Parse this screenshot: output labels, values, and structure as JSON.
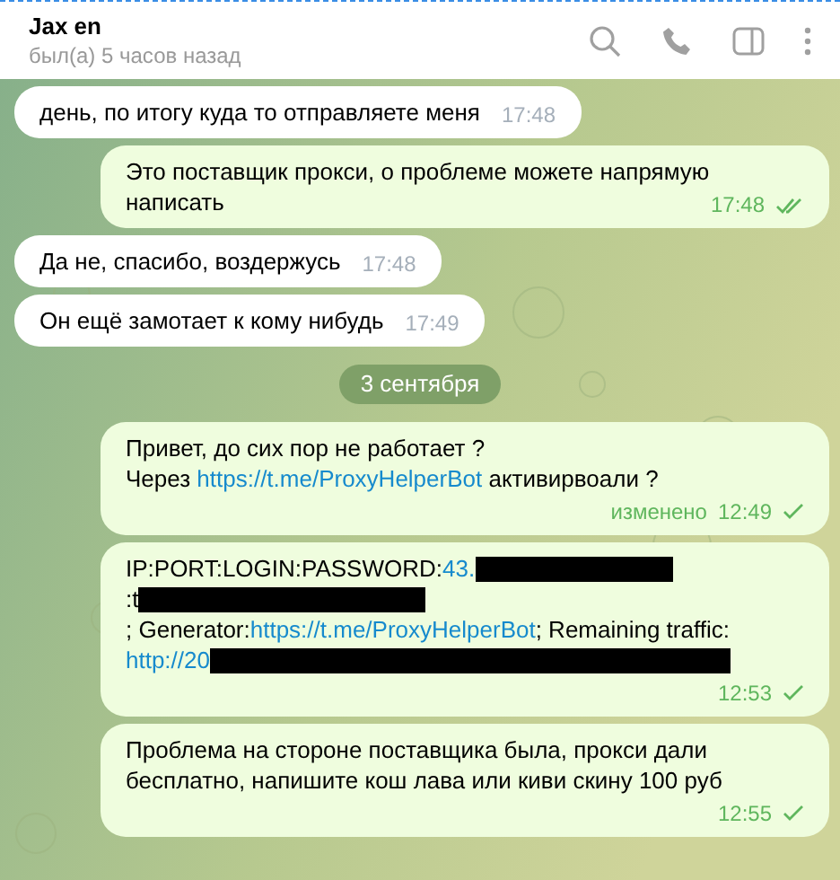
{
  "header": {
    "title": "Jax en",
    "status": "был(а) 5 часов назад"
  },
  "messages": [
    {
      "kind": "in",
      "segments": [
        {
          "kind": "text",
          "text": "день, по итогу куда то отправляете меня"
        }
      ],
      "time": "17:48"
    },
    {
      "kind": "out",
      "segments": [
        {
          "kind": "text",
          "text": "Это поставщик прокси, о проблеме можете напрямую написать"
        }
      ],
      "time": "17:48",
      "read": true
    },
    {
      "kind": "in",
      "segments": [
        {
          "kind": "text",
          "text": "Да не, спасибо, воздержусь"
        }
      ],
      "time": "17:48"
    },
    {
      "kind": "in",
      "segments": [
        {
          "kind": "text",
          "text": "Он ещё замотает к кому нибудь"
        }
      ],
      "time": "17:49"
    },
    {
      "kind": "date",
      "text": "3 сентября"
    },
    {
      "kind": "out",
      "segments": [
        {
          "kind": "text",
          "text": "Привет,  до сих пор не работает ?"
        },
        {
          "kind": "break"
        },
        {
          "kind": "text",
          "text": "Через "
        },
        {
          "kind": "link",
          "text": "https://t.me/ProxyHelperBot"
        },
        {
          "kind": "text",
          "text": " активирвоали ?"
        }
      ],
      "edited": "изменено",
      "time": "12:49",
      "read": false
    },
    {
      "kind": "out",
      "segments": [
        {
          "kind": "text",
          "text": "IP:PORT:LOGIN:PASSWORD:"
        },
        {
          "kind": "link",
          "text": "43."
        },
        {
          "kind": "redacted"
        },
        {
          "kind": "break"
        },
        {
          "kind": "text",
          "text": ":t"
        },
        {
          "kind": "redacted"
        },
        {
          "kind": "break"
        },
        {
          "kind": "text",
          "text": "; Generator:"
        },
        {
          "kind": "link",
          "text": "https://t.me/ProxyHelperBot"
        },
        {
          "kind": "text",
          "text": "; Remaining traffic:"
        },
        {
          "kind": "break"
        },
        {
          "kind": "link",
          "text": "http://20"
        },
        {
          "kind": "redacted"
        }
      ],
      "time": "12:53",
      "read": false
    },
    {
      "kind": "out",
      "segments": [
        {
          "kind": "text",
          "text": "Проблема на стороне поставщика была, прокси дали бесплатно, напишите кош лава или киви скину 100 руб"
        }
      ],
      "time": "12:55",
      "read": false
    }
  ]
}
